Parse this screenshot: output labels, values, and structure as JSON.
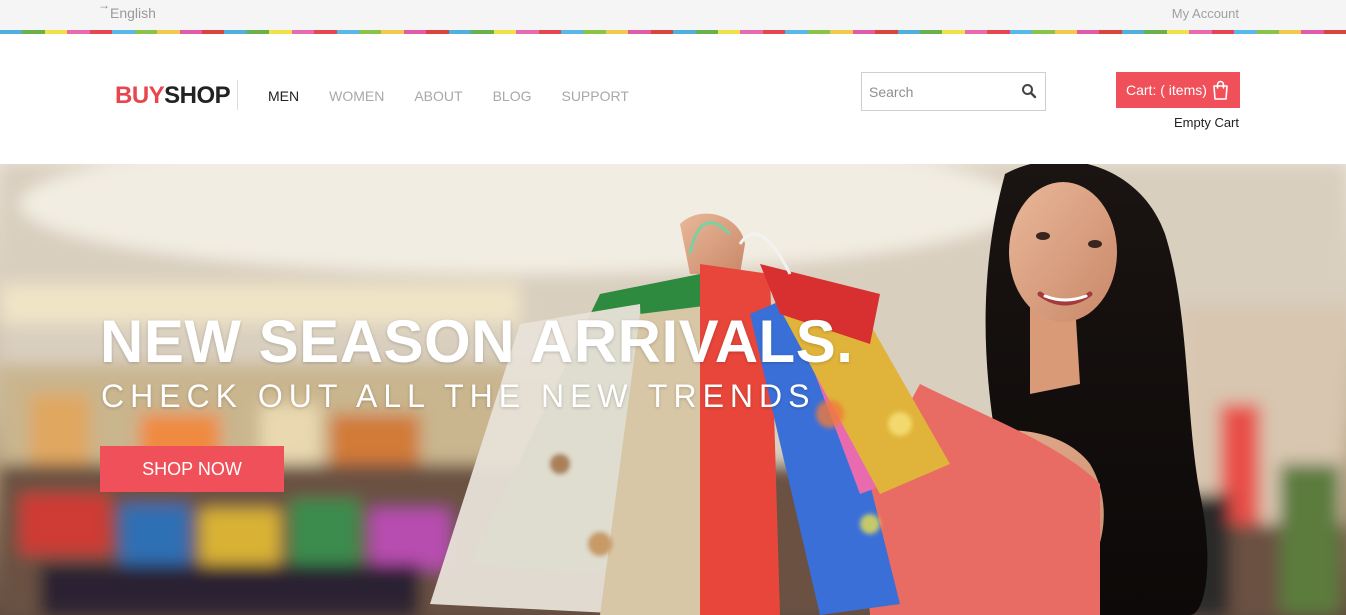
{
  "topbar": {
    "language_arrow": "→",
    "language": "English",
    "my_account": "My Account"
  },
  "stripe_colors": [
    "#4fb0e0",
    "#6ab04c",
    "#f0e04a",
    "#e86bb0",
    "#e8464f",
    "#5ab8e8",
    "#8ac24a",
    "#f2c94c",
    "#e25aa8",
    "#d9453d"
  ],
  "header": {
    "logo_buy": "BUY",
    "logo_shop": "SHOP",
    "nav": [
      {
        "label": "MEN",
        "active": true
      },
      {
        "label": "WOMEN",
        "active": false
      },
      {
        "label": "ABOUT",
        "active": false
      },
      {
        "label": "BLOG",
        "active": false
      },
      {
        "label": "SUPPORT",
        "active": false
      }
    ],
    "search": {
      "placeholder": "Search",
      "value": "",
      "icon": "search-icon"
    },
    "cart": {
      "label": "Cart: ( items)",
      "icon": "shopping-bag-icon"
    },
    "empty_cart": "Empty Cart"
  },
  "hero": {
    "title": "NEW SEASON ARRIVALS.",
    "subtitle": "CHECK OUT ALL THE NEW TRENDS",
    "cta": "SHOP NOW"
  },
  "colors": {
    "accent": "#f0505a",
    "logo_red": "#e8464f",
    "text_dark": "#222222",
    "text_muted": "#a8a8a8"
  }
}
